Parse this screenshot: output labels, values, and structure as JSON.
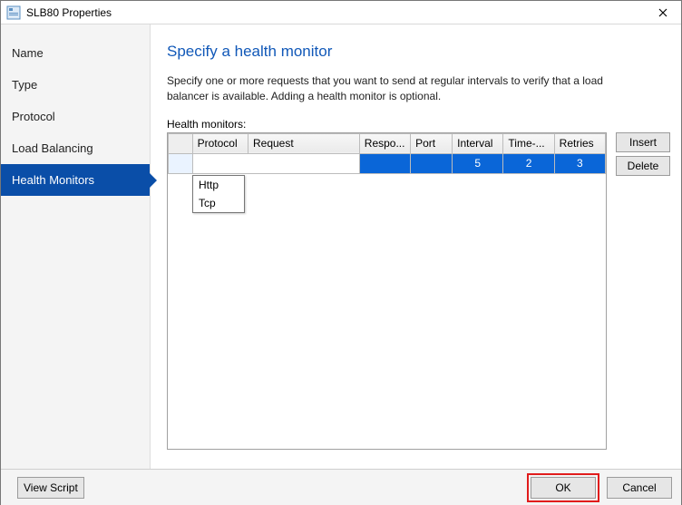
{
  "window": {
    "title": "SLB80 Properties"
  },
  "sidebar": {
    "items": [
      {
        "label": "Name"
      },
      {
        "label": "Type"
      },
      {
        "label": "Protocol"
      },
      {
        "label": "Load Balancing"
      },
      {
        "label": "Health Monitors",
        "active": true
      }
    ]
  },
  "main": {
    "heading": "Specify a health monitor",
    "description": "Specify one or more requests that you want to send at regular intervals to verify that a load balancer is available. Adding a health monitor is optional.",
    "grid_label": "Health monitors:",
    "columns": {
      "protocol": "Protocol",
      "request": "Request",
      "response": "Respo...",
      "port": "Port",
      "interval": "Interval",
      "timeout": "Time-...",
      "retries": "Retries"
    },
    "row": {
      "protocol": "",
      "request": "",
      "response": "",
      "port": "",
      "interval": "5",
      "timeout": "2",
      "retries": "3"
    },
    "protocol_options": [
      "Http",
      "Tcp"
    ],
    "buttons": {
      "insert": "Insert",
      "delete": "Delete"
    }
  },
  "footer": {
    "view_script": "View Script",
    "ok": "OK",
    "cancel": "Cancel"
  }
}
